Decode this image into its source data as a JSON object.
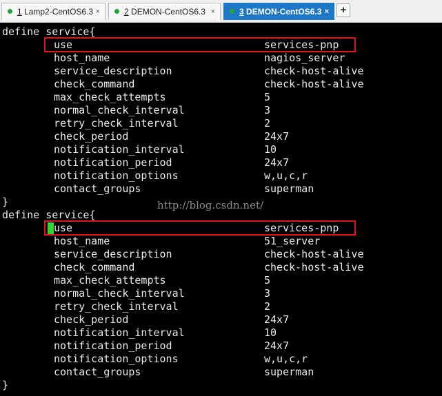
{
  "tabs": [
    {
      "number": "1",
      "label": "Lamp2-CentOS6.3",
      "active": false,
      "status_color": "#22a63a"
    },
    {
      "number": "2",
      "label": "DEMON-CentOS6.3",
      "active": false,
      "status_color": "#22a63a"
    },
    {
      "number": "3",
      "label": "DEMON-CentOS6.3",
      "active": true,
      "status_color": "#22a63a"
    }
  ],
  "tab_close_label": "×",
  "new_tab_label": "+",
  "colors": {
    "active_tab": "#1e78c8",
    "highlight_box": "#e0141c",
    "cursor": "#2ed62e",
    "terminal_bg": "#000000",
    "terminal_fg": "#eaeaea"
  },
  "terminal": {
    "block1": {
      "header": "define service{",
      "rows": [
        {
          "key": "use",
          "value": "services-pnp"
        },
        {
          "key": "host_name",
          "value": "nagios_server"
        },
        {
          "key": "service_description",
          "value": "check-host-alive"
        },
        {
          "key": "check_command",
          "value": "check-host-alive"
        },
        {
          "key": "max_check_attempts",
          "value": "5"
        },
        {
          "key": "normal_check_interval",
          "value": "3"
        },
        {
          "key": "retry_check_interval",
          "value": "2"
        },
        {
          "key": "check_period",
          "value": "24x7"
        },
        {
          "key": "notification_interval",
          "value": "10"
        },
        {
          "key": "notification_period",
          "value": "24x7"
        },
        {
          "key": "notification_options",
          "value": "w,u,c,r"
        },
        {
          "key": "contact_groups",
          "value": "superman"
        }
      ],
      "footer": "}"
    },
    "block2": {
      "header": "define service{",
      "rows": [
        {
          "key": "use",
          "value": "services-pnp"
        },
        {
          "key": "host_name",
          "value": "51_server"
        },
        {
          "key": "service_description",
          "value": "check-host-alive"
        },
        {
          "key": "check_command",
          "value": "check-host-alive"
        },
        {
          "key": "max_check_attempts",
          "value": "5"
        },
        {
          "key": "normal_check_interval",
          "value": "3"
        },
        {
          "key": "retry_check_interval",
          "value": "2"
        },
        {
          "key": "check_period",
          "value": "24x7"
        },
        {
          "key": "notification_interval",
          "value": "10"
        },
        {
          "key": "notification_period",
          "value": "24x7"
        },
        {
          "key": "notification_options",
          "value": "w,u,c,r"
        },
        {
          "key": "contact_groups",
          "value": "superman"
        }
      ],
      "footer": "}"
    },
    "watermark": "http://blog.csdn.net/"
  }
}
